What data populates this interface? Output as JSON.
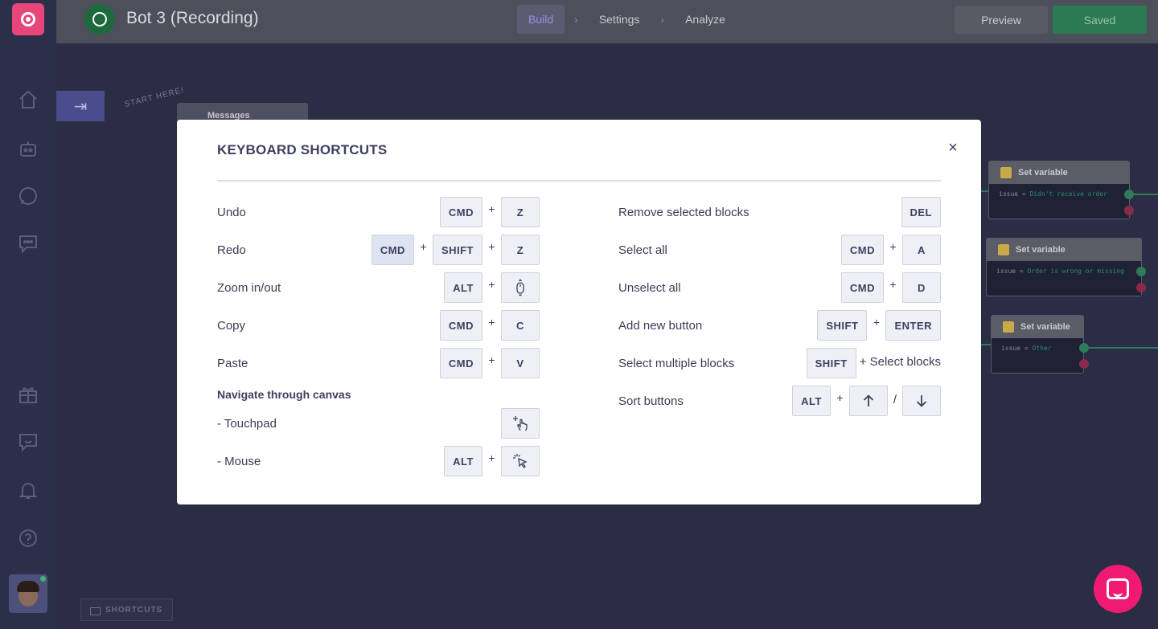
{
  "header": {
    "bot_title": "Bot 3 (Recording)",
    "crumbs": [
      "Build",
      "Settings",
      "Analyze"
    ],
    "preview_label": "Preview",
    "saved_label": "Saved"
  },
  "canvas": {
    "start_here": "START HERE!",
    "messages_card": "Messages",
    "set_variable_cards": [
      {
        "title": "Set variable",
        "var": "issue",
        "value": "Didn't receive order"
      },
      {
        "title": "Set variable",
        "var": "issue",
        "value": "Order is wrong or missing"
      },
      {
        "title": "Set variable",
        "var": "issue",
        "value": "Other"
      }
    ],
    "shortcuts_button": "SHORTCUTS"
  },
  "modal": {
    "title": "KEYBOARD SHORTCUTS",
    "close_icon": "×",
    "left": [
      {
        "label": "Undo",
        "keys": [
          "CMD",
          "Z"
        ]
      },
      {
        "label": "Redo",
        "keys": [
          "CMD",
          "SHIFT",
          "Z"
        ]
      },
      {
        "label": "Zoom in/out",
        "keys": [
          "ALT",
          "mouse-scroll-icon"
        ]
      },
      {
        "label": "Copy",
        "keys": [
          "CMD",
          "C"
        ]
      },
      {
        "label": "Paste",
        "keys": [
          "CMD",
          "V"
        ]
      },
      {
        "label": "Navigate through canvas"
      },
      {
        "label": "- Touchpad",
        "keys": [
          "touchpad-drag-icon"
        ]
      },
      {
        "label": "- Mouse",
        "keys": [
          "ALT",
          "mouse-click-icon"
        ]
      }
    ],
    "right": [
      {
        "label": "Remove selected blocks",
        "keys": [
          "DEL"
        ]
      },
      {
        "label": "Select all",
        "keys": [
          "CMD",
          "A"
        ]
      },
      {
        "label": "Unselect all",
        "keys": [
          "CMD",
          "D"
        ]
      },
      {
        "label": "Add new button",
        "keys": [
          "SHIFT",
          "ENTER"
        ]
      },
      {
        "label": "Select multiple blocks",
        "keys": [
          "SHIFT"
        ],
        "suffix": "+ Select blocks"
      },
      {
        "label": "Sort buttons",
        "keys": [
          "ALT",
          "arrow-up-icon",
          "arrow-down-icon"
        ]
      }
    ],
    "plus": "+",
    "slash": "/"
  },
  "icons": {
    "sidebar": [
      "home-icon",
      "bot-icon",
      "whatsapp-icon",
      "chat-icon",
      "gift-icon",
      "feedback-icon",
      "bell-icon",
      "help-icon"
    ]
  },
  "colors": {
    "accent": "#e8457b",
    "saved": "#2c7a53",
    "chat_fab": "#f01a72"
  }
}
